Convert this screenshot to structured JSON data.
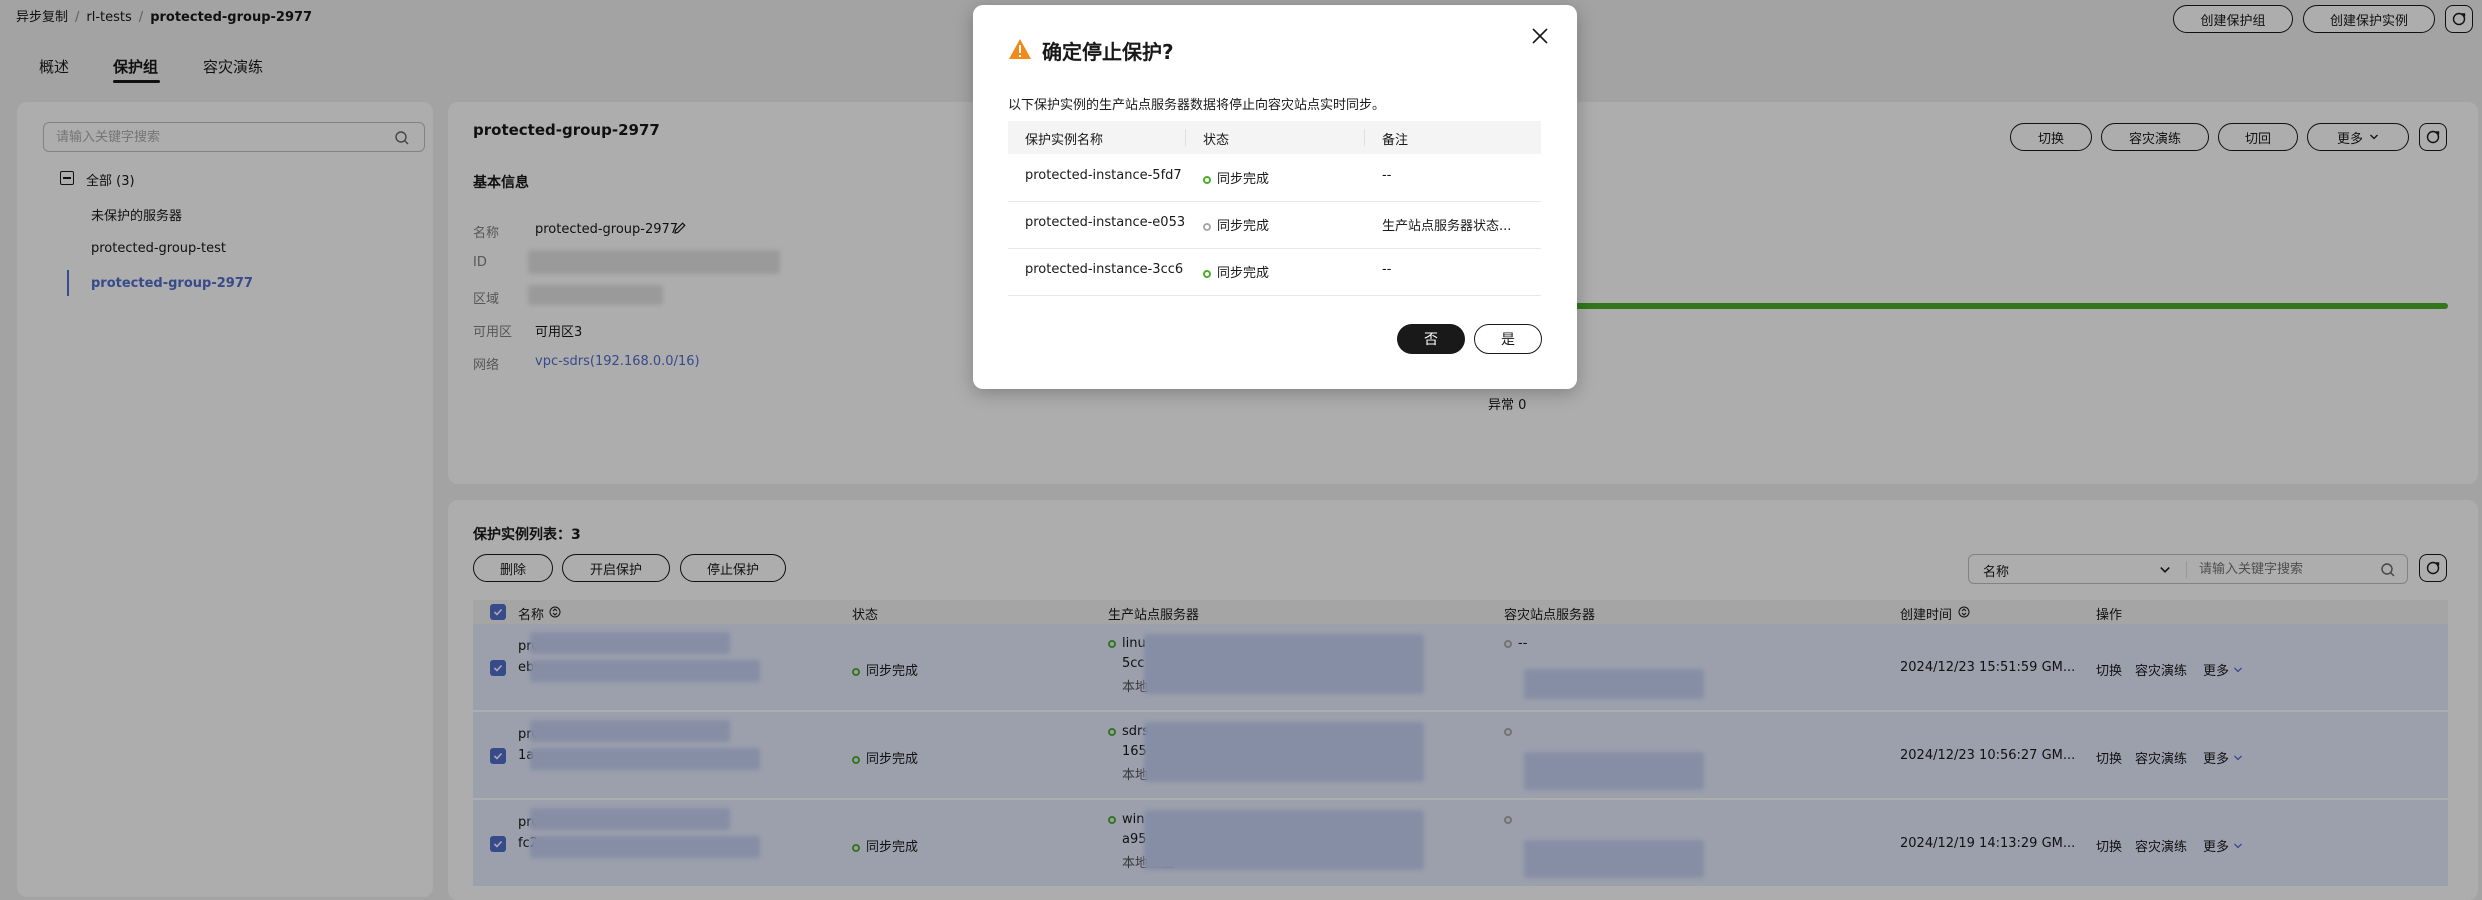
{
  "breadcrumb": [
    "异步复制",
    "rl-tests",
    "protected-group-2977"
  ],
  "header_buttons": {
    "create_group": "创建保护组",
    "create_instance": "创建保护实例"
  },
  "tabs": [
    "概述",
    "保护组",
    "容灾演练"
  ],
  "sidebar": {
    "search_placeholder": "请输入关键字搜索",
    "all_label": "全部 (3)",
    "items": [
      "未保护的服务器",
      "protected-group-test",
      "protected-group-2977"
    ]
  },
  "detail": {
    "title": "protected-group-2977",
    "basic_info_title": "基本信息",
    "fields": {
      "name_label": "名称",
      "name_value": "protected-group-2977",
      "id_label": "ID",
      "region_label": "区域",
      "az_label": "可用区",
      "az_value": "可用区3",
      "network_label": "网络",
      "network_value": "vpc-sdrs(192.168.0.0/16)"
    },
    "actions": {
      "switch": "切换",
      "drill": "容灾演练",
      "failback": "切回",
      "more": "更多"
    },
    "abnormal": "异常 0",
    "progress": 1.0
  },
  "instances": {
    "title": "保护实例列表：",
    "count": "3",
    "buttons": {
      "delete": "删除",
      "start": "开启保护",
      "stop": "停止保护"
    },
    "filter_select": "名称",
    "filter_placeholder": "请输入关键字搜索",
    "columns": {
      "name": "名称",
      "status": "状态",
      "prod_server": "生产站点服务器",
      "dr_server": "容灾站点服务器",
      "created": "创建时间",
      "ops": "操作"
    },
    "rows": [
      {
        "name_prefix": "pro",
        "name_sub": "eb",
        "status": "同步完成",
        "prod_l1": "linu",
        "prod_l2": "5cc",
        "prod_l3": "本地",
        "dr": "--",
        "created": "2024/12/23 15:51:59 GM...",
        "op_switch": "切换",
        "op_drill": "容灾演练",
        "op_more": "更多"
      },
      {
        "name_prefix": "pro",
        "name_sub": "1a",
        "status": "同步完成",
        "prod_l1": "sdrs",
        "prod_l2": "165",
        "prod_l3": "本地",
        "dr": "",
        "created": "2024/12/23 10:56:27 GM...",
        "op_switch": "切换",
        "op_drill": "容灾演练",
        "op_more": "更多"
      },
      {
        "name_prefix": "pro",
        "name_sub": "fc2",
        "status": "同步完成",
        "prod_l1": "win",
        "prod_l2": "a95",
        "prod_l3": "本地磁盘",
        "dr": "",
        "created": "2024/12/19 14:13:29 GM...",
        "op_switch": "切换",
        "op_drill": "容灾演练",
        "op_more": "更多"
      }
    ]
  },
  "dialog": {
    "title": "确定停止保护?",
    "description": "以下保护实例的生产站点服务器数据将停止向容灾站点实时同步。",
    "columns": {
      "name": "保护实例名称",
      "status": "状态",
      "note": "备注"
    },
    "rows": [
      {
        "name": "protected-instance-5fd7",
        "status": "同步完成",
        "note": "--"
      },
      {
        "name": "protected-instance-e053",
        "status": "同步完成",
        "note": "生产站点服务器状态..."
      },
      {
        "name": "protected-instance-3cc6",
        "status": "同步完成",
        "note": "--"
      }
    ],
    "no": "否",
    "yes": "是"
  }
}
